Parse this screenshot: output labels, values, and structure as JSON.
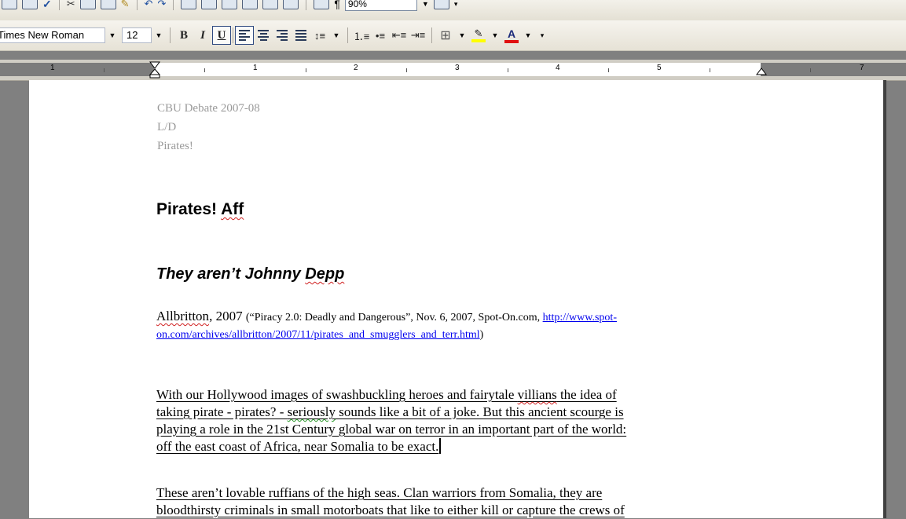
{
  "formatting": {
    "font_name": "Times New Roman",
    "font_size": "12",
    "bold_label": "B",
    "italic_label": "I",
    "underline_label": "U",
    "zoom": "90%"
  },
  "ruler": {
    "numbers": [
      "1",
      "1",
      "2",
      "3",
      "4",
      "5",
      "7"
    ]
  },
  "document": {
    "header_lines": [
      "CBU Debate 2007-08",
      "L/D",
      "Pirates!"
    ],
    "heading1_a": "Pirates!",
    "heading1_b": "Aff",
    "heading2_a": "They aren’t Johnny",
    "heading2_b": "Depp",
    "cite_author": "Allbritton",
    "cite_year": ", 2007 ",
    "cite_detail": "(“Piracy 2.0: Deadly and Dangerous”, Nov. 6, 2007, Spot-On.com, ",
    "cite_link_1": "http://www.spot-",
    "cite_link_2": "on.com/archives/allbritton/2007/11/pirates_and_smugglers_and_terr.html",
    "cite_close": ")",
    "para1": [
      "With our Hollywood images of swashbuckling heroes and fairytale ",
      "villians",
      " the idea of",
      "taking pirate - pirates? - ",
      "seriously",
      " sounds like a bit of a joke. But this ancient scourge is",
      "playing a role in the 21st Century global war on terror in an important part of the world:",
      "off the east coast of Africa, near Somalia to be exact."
    ],
    "para2": [
      "These aren’t lovable ruffians of the high seas. Clan warriors from Somalia, they are",
      "bloodthirsty criminals in small motorboats that like to either kill or capture the crews of"
    ]
  },
  "colors": {
    "highlight": "#ffff00",
    "font_color": "#e01010",
    "header_text": "#9a9a9a",
    "link": "#0000ee"
  }
}
